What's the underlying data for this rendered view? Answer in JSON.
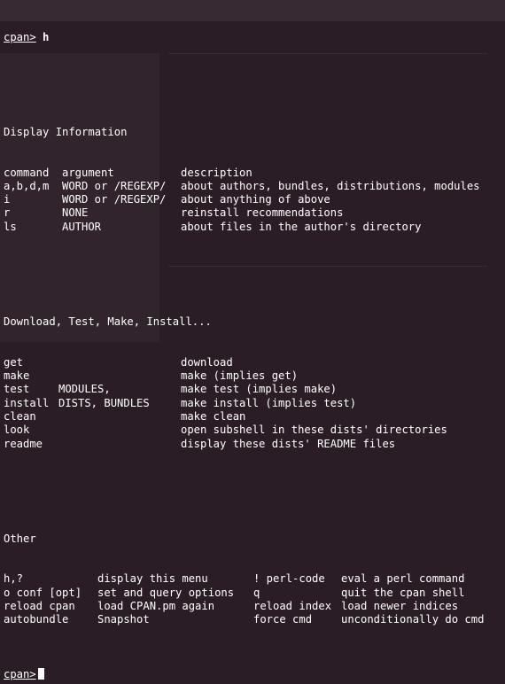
{
  "prompt": {
    "label": "cpan>",
    "command": "h",
    "final_label": "cpan>"
  },
  "sections": {
    "display": {
      "title": "Display Information",
      "headers": [
        "command",
        "argument",
        "description"
      ],
      "rows": [
        [
          "a,b,d,m",
          "WORD or /REGEXP/",
          "about authors, bundles, distributions, modules"
        ],
        [
          "i",
          "WORD or /REGEXP/",
          "about anything of above"
        ],
        [
          "r",
          "NONE",
          "reinstall recommendations"
        ],
        [
          "ls",
          "AUTHOR",
          "about files in the author's directory"
        ]
      ]
    },
    "download": {
      "title": "Download, Test, Make, Install...",
      "rows": [
        [
          "get",
          "",
          "download"
        ],
        [
          "make",
          "",
          "make (implies get)"
        ],
        [
          "test",
          "MODULES,",
          "make test (implies make)"
        ],
        [
          "install",
          "DISTS, BUNDLES",
          "make install (implies test)"
        ],
        [
          "clean",
          "",
          "make clean"
        ],
        [
          "look",
          "",
          "open subshell in these dists' directories"
        ],
        [
          "readme",
          "",
          "display these dists' README files"
        ]
      ]
    },
    "other": {
      "title": "Other",
      "rows": [
        [
          "h,?",
          "display this menu",
          "! perl-code",
          "eval a perl command"
        ],
        [
          "o conf [opt]",
          "set and query options",
          "q",
          "quit the cpan shell"
        ],
        [
          "reload cpan",
          "load CPAN.pm again",
          "reload index",
          "load newer indices"
        ],
        [
          "autobundle",
          "Snapshot",
          "force cmd",
          "unconditionally do cmd"
        ]
      ]
    }
  },
  "colors": {
    "background": "#2b1d26",
    "text": "#ffffff"
  }
}
